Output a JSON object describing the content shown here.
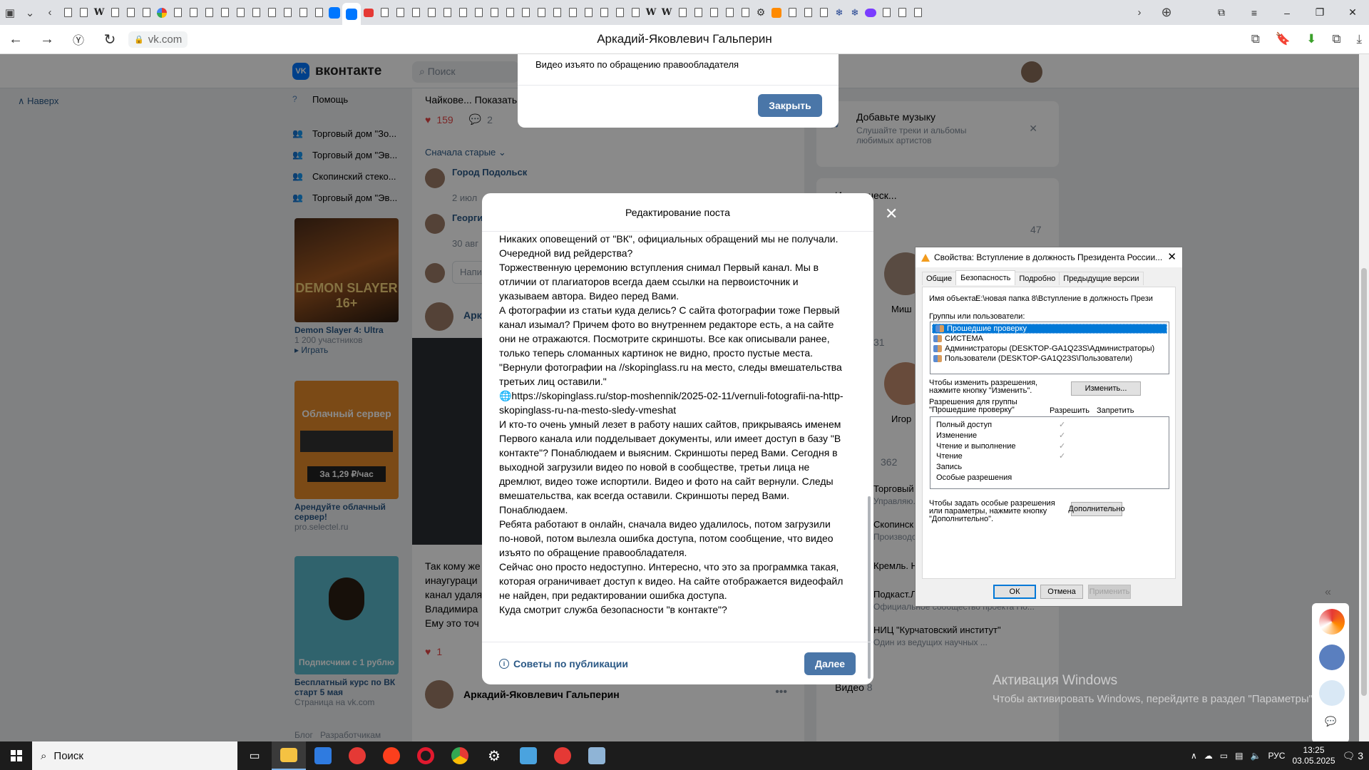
{
  "browser": {
    "url": "vk.com",
    "page_title": "Аркадий-Яковлевич Гальперин",
    "colors": {
      "accent": "#4a76a8",
      "vk_blue": "#0077ff"
    }
  },
  "vk": {
    "logo_text": "вконтакте",
    "search_placeholder": "Поиск",
    "back_link": "Наверх",
    "nav": {
      "help": "Помощь",
      "items": [
        "Торговый дом \"Зо...",
        "Торговый дом \"Эв...",
        "Скопинский стекo...",
        "Торговый дом \"Эв..."
      ]
    },
    "ads": [
      {
        "title": "Demon Slayer 4: Ultra",
        "sub": "1 200 участников",
        "action": "▸ Играть",
        "img_text": "DEMON SLAYER 16+"
      },
      {
        "title": "Арендуйте облачный сервер!",
        "sub": "pro.selectel.ru",
        "img_title": "Облачный сервер",
        "img_price": "За 1,29 ₽/час"
      },
      {
        "title": "Бесплатный курс по ВК старт 5 мая",
        "sub": "Страница на vk.com",
        "img_text": "Подписчики с 1 рублю"
      }
    ],
    "footer": [
      "Блог",
      "Разработчикам"
    ]
  },
  "feed": {
    "snippet_line": "Чайкове...  Показать",
    "likes_1": "159",
    "comments_1": "2",
    "sort_label": "Сначала старые",
    "comments": [
      {
        "name": "Город Подольск",
        "date": "2 июл"
      },
      {
        "name": "Георги",
        "date": "30 авг"
      }
    ],
    "reply_placeholder": "Напи",
    "post_author_partial": "Арка",
    "text_lines": [
      "Так кому же",
      "инаугураци",
      "канал удаля",
      "Владимира",
      "Ему это точ"
    ],
    "likes_2": "1",
    "post_author": "Аркадий-Яковлевич Гальперин"
  },
  "right": {
    "music": {
      "title": "Добавьте музыку",
      "sub": "Слушайте треки и альбомы любимых артистов"
    },
    "history_title": "Историческ...",
    "count_1": "47",
    "friend_1": "Миш",
    "count_2": "31",
    "friend_2": "Игор",
    "count_3": "362",
    "groups": [
      {
        "name": "Торговый",
        "sub": "Управляю..."
      },
      {
        "name": "Скопинск",
        "sub": "Производство стекла: стеклотары, си..."
      },
      {
        "name": "Кремль. Новости",
        "sub": ""
      },
      {
        "name": "Подкаст.Лаб",
        "sub": "Официальное сообщество проекта По..."
      },
      {
        "name": "НИЦ \"Курчатовский институт\"",
        "sub": "Один из ведущих научных ..."
      }
    ],
    "video_label": "Видео",
    "video_count": "8"
  },
  "popup": {
    "message": "Видео изъято по обращению правообладателя",
    "close_button": "Закрыть"
  },
  "modal": {
    "title": "Редактирование поста",
    "paragraphs": [
      "Никаких оповещений от \"ВК\", официальных обращений мы не получали. Очередной вид рейдерства?",
      "Торжественную церемонию вступления снимал Первый канал. Мы в отличии от плагиаторов всегда даем ссылки на первоисточник и указываем автора. Видео перед Вами.",
      "А фотографии из статьи куда делись? С сайта фотографии тоже Первый канал изымал? Причем фото во внутреннем редакторе есть, а на сайте они не отражаются. Посмотрите скриншоты. Все как описывали ранее, только теперь сломанных картинок не видно, просто пустые места.",
      "\"Вернули фотографии на //skopinglass.ru на место, следы вмешательства третьих лиц оставили.\"",
      "🌐https://skopinglass.ru/stop-moshennik/2025-02-11/vernuli-fotografii-na-http-skopinglass-ru-na-mesto-sledy-vmeshat",
      "И кто-то очень умный лезет в работу наших сайтов, прикрываясь именем Первого канала или подделывает документы, или имеет доступ в базу \"В контакте\"? Понаблюдаем и выясним. Скриншоты перед Вами. Сегодня в выходной загрузили видео по новой в сообществе, третьи лица не дремлют, видео тоже испортили. Видео и фото на сайт вернули. Следы вмешательства, как всегда оставили. Скриншоты перед Вами. Понаблюдаем.",
      "Ребята работают в онлайн, сначала видео удалилось, потом загрузили по-новой, потом вылезла ошибка доступа, потом сообщение, что видео изъято по обращение правообладателя.",
      "Сейчас оно просто недоступно. Интересно, что это за программка такая, которая ограничивает доступ к видео. На сайте отображается видеофайл не найден, при редактировании ошибка доступа.",
      "Куда смотрит служба безопасности \"в контакте\"?"
    ],
    "tips_link": "Советы по публикации",
    "next_button": "Далее"
  },
  "properties": {
    "title": "Свойства: Вступление в должность Президента России...",
    "tabs": [
      "Общие",
      "Безопасность",
      "Подробно",
      "Предыдущие версии"
    ],
    "active_tab": "Безопасность",
    "object_label": "Имя объекта:",
    "object_value": "E:\\новая папка 8\\Вступление в должность Прези",
    "groups_label": "Группы или пользователи:",
    "groups": [
      "Прошедшие проверку",
      "СИСТЕМА",
      "Администраторы (DESKTOP-GA1Q23S\\Администраторы)",
      "Пользователи (DESKTOP-GA1Q23S\\Пользователи)"
    ],
    "change_hint": "Чтобы изменить разрешения, нажмите кнопку \"Изменить\".",
    "change_button": "Изменить...",
    "perm_label": "Разрешения для группы \"Прошедшие проверку\"",
    "allow_col": "Разрешить",
    "deny_col": "Запретить",
    "permissions": [
      {
        "name": "Полный доступ",
        "allow": ""
      },
      {
        "name": "Изменение",
        "allow": "✓"
      },
      {
        "name": "Чтение и выполнение",
        "allow": "✓"
      },
      {
        "name": "Чтение",
        "allow": "✓"
      },
      {
        "name": "Запись",
        "allow": "✓"
      },
      {
        "name": "Особые разрешения",
        "allow": ""
      }
    ],
    "special_hint": "Чтобы задать особые разрешения или параметры, нажмите кнопку \"Дополнительно\".",
    "advanced_button": "Дополнительно",
    "ok": "ОК",
    "cancel": "Отмена",
    "apply": "Применить"
  },
  "watermark": {
    "title": "Активация Windows",
    "sub": "Чтобы активировать Windows, перейдите в раздел \"Параметры\"."
  },
  "taskbar": {
    "search": "Поиск",
    "lang": "РУС",
    "time": "13:25",
    "date": "03.05.2025",
    "notifications": "3"
  }
}
